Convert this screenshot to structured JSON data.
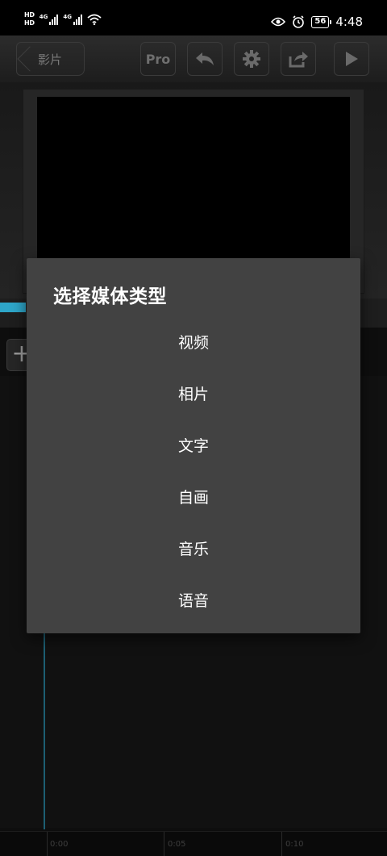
{
  "status_bar": {
    "hd1": "HD",
    "hd2": "HD",
    "net1": "4G",
    "net2": "4G",
    "battery": "56",
    "time": "4:48"
  },
  "toolbar": {
    "back_label": "影片",
    "pro_label": "Pro"
  },
  "timeline": {
    "ticks": [
      "0:00",
      "0:05",
      "0:10"
    ]
  },
  "dialog": {
    "title": "选择媒体类型",
    "options": [
      "视频",
      "相片",
      "文字",
      "自画",
      "音乐",
      "语音"
    ]
  },
  "colors": {
    "accent": "#2ea6c9",
    "dialog_bg": "#424242"
  }
}
